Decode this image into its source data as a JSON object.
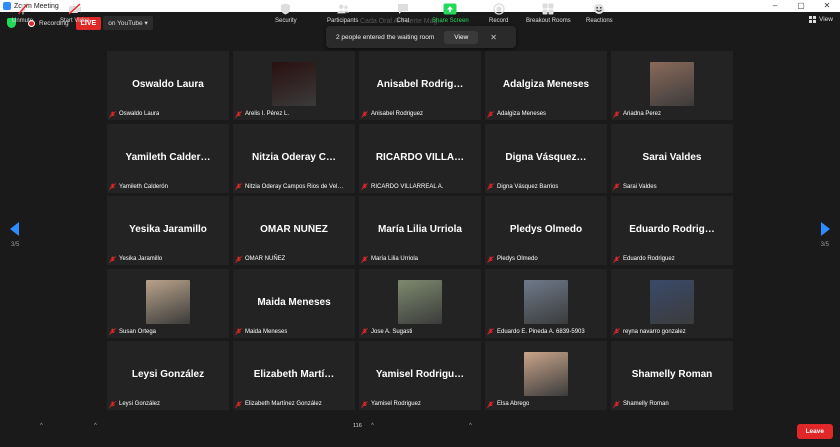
{
  "window": {
    "title": "Zoom Meeting",
    "controls": [
      "–",
      "▢",
      "✕"
    ]
  },
  "topbar": {
    "recording_label": "Recording",
    "live_label": "LIVE",
    "stream_label": "on YouTube ▾",
    "view_label": "View",
    "ghost_text": "Cada Oral Al Fuerte Mag..."
  },
  "notification": {
    "message": "2 people entered the waiting room",
    "button": "View",
    "close": "✕"
  },
  "pagination": {
    "left": "3/5",
    "right": "3/5"
  },
  "participants": [
    {
      "big": "Oswaldo Laura",
      "label": "Oswaldo Laura",
      "video": false
    },
    {
      "big": "",
      "label": "Arelis I. Pérez L.",
      "video": true,
      "photo_color": "#2a0f0f"
    },
    {
      "big": "Anisabel  Rodrig…",
      "label": "Anisabel Rodriguez",
      "video": false
    },
    {
      "big": "Adalgiza Meneses",
      "label": "Adalgiza Meneses",
      "video": false
    },
    {
      "big": "",
      "label": "Ariadna Perez",
      "video": true,
      "photo_color": "#8a6a5a"
    },
    {
      "big": "Yamileth  Calder…",
      "label": "Yamileth Calderón",
      "video": false
    },
    {
      "big": "Nitzia  Oderay  C…",
      "label": "Nitzia Oderay Campos Rios de Vel…",
      "video": false
    },
    {
      "big": "RICARDO  VILLA…",
      "label": "RICARDO VILLARREAL A.",
      "video": false
    },
    {
      "big": "Digna  Vásquez…",
      "label": "Digna Vásquez Barrios",
      "video": false
    },
    {
      "big": "Sarai Valdes",
      "label": "Sarai Valdes",
      "video": false
    },
    {
      "big": "Yesika Jaramillo",
      "label": "Yesika Jaramillo",
      "video": false
    },
    {
      "big": "OMAR NUÑEZ",
      "label": "OMAR NUÑEZ",
      "video": false
    },
    {
      "big": "María Lilia Urriola",
      "label": "María Lilia Urriola",
      "video": false
    },
    {
      "big": "Pledys Olmedo",
      "label": "Pledys Olmedo",
      "video": false
    },
    {
      "big": "Eduardo  Rodrig…",
      "label": "Eduardo Rodriguez",
      "video": false
    },
    {
      "big": "",
      "label": "Susan Ortega",
      "video": true,
      "photo_color": "#b9a38a"
    },
    {
      "big": "Maida Meneses",
      "label": "Maida Meneses",
      "video": false
    },
    {
      "big": "",
      "label": "Jose A. Sugasti",
      "video": true,
      "photo_color": "#7d8a6e"
    },
    {
      "big": "",
      "label": "Eduardo E. Pineda A. 6839-5903",
      "video": true,
      "photo_color": "#6e7a8a"
    },
    {
      "big": "",
      "label": "reyna navarro gonzalez",
      "video": true,
      "photo_color": "#3a4a6a"
    },
    {
      "big": "Leysi González",
      "label": "Leysi González",
      "video": false
    },
    {
      "big": "Elizabeth  Martí…",
      "label": "Elizabeth Martínez González",
      "video": false
    },
    {
      "big": "Yamisel  Rodrigu…",
      "label": "Yamisel Rodriguez",
      "video": false
    },
    {
      "big": "",
      "label": "Elsa Abrego",
      "video": true,
      "photo_color": "#c9a58a"
    },
    {
      "big": "Shamelly Roman",
      "label": "Shamelly Roman",
      "video": false
    }
  ],
  "toolbar": {
    "unmute": "Unmute",
    "start_video": "Start Video",
    "security": "Security",
    "participants": "Participants",
    "participants_count": "116",
    "chat": "Chat",
    "share_screen": "Share Screen",
    "record": "Record",
    "breakout_rooms": "Breakout Rooms",
    "reactions": "Reactions",
    "leave": "Leave"
  },
  "colors": {
    "accent": "#2d8cff",
    "live": "#e02828",
    "share": "#23d959",
    "muted_mic": "#e02828"
  }
}
